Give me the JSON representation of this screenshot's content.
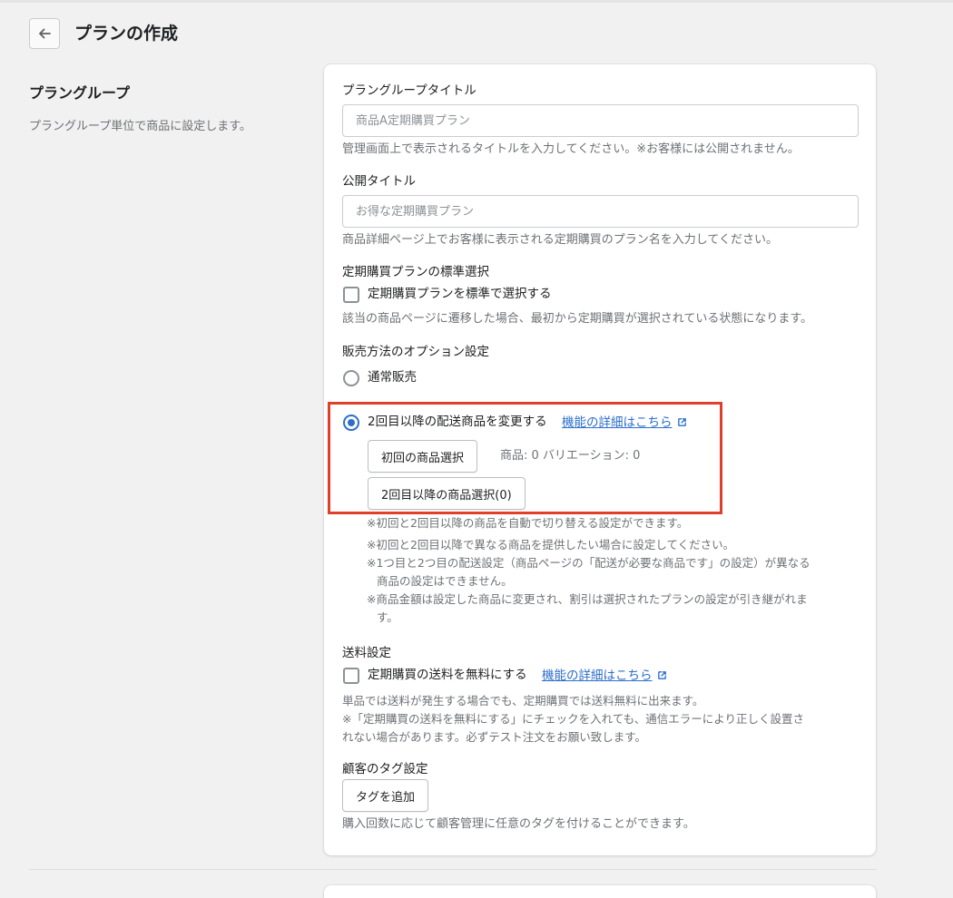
{
  "header": {
    "title": "プランの作成"
  },
  "section": {
    "heading": "プラングループ",
    "description": "プラングループ単位で商品に設定します。"
  },
  "group_title": {
    "label": "プラングループタイトル",
    "value": "商品A定期購買プラン",
    "help": "管理画面上で表示されるタイトルを入力してください。※お客様には公開されません。"
  },
  "public_title": {
    "label": "公開タイトル",
    "value": "お得な定期購買プラン",
    "help": "商品詳細ページ上でお客様に表示される定期購買のプラン名を入力してください。"
  },
  "default_select": {
    "label": "定期購買プランの標準選択",
    "checkbox_label": "定期購買プランを標準で選択する",
    "checked": false,
    "help": "該当の商品ページに遷移した場合、最初から定期購買が選択されている状態になります。"
  },
  "sales_method": {
    "label": "販売方法のオプション設定",
    "option_normal": "通常販売",
    "option_change": "2回目以降の配送商品を変更する",
    "selected": "option_change",
    "detail_link": "機能の詳細はこちら",
    "first_select_button": "初回の商品選択",
    "count_text": "商品: 0 バリエーション: 0",
    "second_select_button": "2回目以降の商品選択(0)",
    "notes": [
      "※初回と2回目以降の商品を自動で切り替える設定ができます。",
      "※初回と2回目以降で異なる商品を提供したい場合に設定してください。",
      "※1つ目と2つ目の配送設定（商品ページの「配送が必要な商品です」の設定）が異なる",
      "商品の設定はできません。",
      "※商品金額は設定した商品に変更され、割引は選択されたプランの設定が引き継がれま",
      "す。"
    ]
  },
  "shipping": {
    "label": "送料設定",
    "checkbox_label": "定期購買の送料を無料にする",
    "checked": false,
    "detail_link": "機能の詳細はこちら",
    "help_lines": [
      "単品では送料が発生する場合でも、定期購買では送料無料に出来ます。",
      "※「定期購買の送料を無料にする」にチェックを入れても、通信エラーにより正しく設置さ",
      "れない場合があります。必ずテスト注文をお願い致します。"
    ]
  },
  "customer_tag": {
    "label": "顧客のタグ設定",
    "button": "タグを追加",
    "help": "購入回数に応じて顧客管理に任意のタグを付けることができます。"
  },
  "colors": {
    "accent": "#2c6ecb",
    "highlight": "#e0402a",
    "background": "#f1f1f1"
  }
}
